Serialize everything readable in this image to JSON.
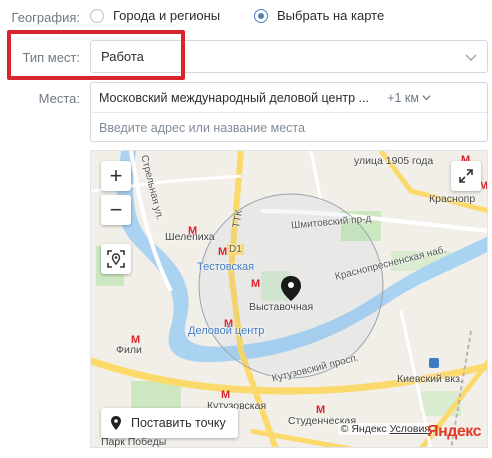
{
  "geography": {
    "label": "География:",
    "options": [
      {
        "label": "Города и регионы",
        "checked": false
      },
      {
        "label": "Выбрать на карте",
        "checked": true
      }
    ]
  },
  "place_type": {
    "label": "Тип мест:",
    "value": "Работа",
    "highlight_color": "#d9262e"
  },
  "places": {
    "label": "Места:",
    "selected": "Московский международный деловой центр ...",
    "radius": "+1 км",
    "input_placeholder": "Введите адрес или название места"
  },
  "map": {
    "zoom_in": "+",
    "zoom_out": "−",
    "set_point_label": "Поставить точку",
    "copyright": "© Яндекс",
    "terms": "Условия",
    "logo": "Яндекс",
    "labels": {
      "shelepikha": "Шелепиха",
      "testovskaya": "Тестовская",
      "vystavochnaya": "Выставочная",
      "delovoy": "Деловой центр",
      "fili": "Фили",
      "kutuzovskaya": "Кутузовская",
      "studencheskaya": "Студенческая",
      "park_pobedy": "Парк Победы",
      "kievsky": "Киевский вкз.",
      "krasnopr": "Краснопр",
      "year_street": "улица 1905 года",
      "shmitovsky": "Шмитовский пр-д",
      "krasnopresnenskaya": "Краснопресненская наб.",
      "kutuzovsky_prosp": "Кутузовский просп.",
      "ttk": "ТТК",
      "d1": "D1",
      "strelna": "Стрельная ул."
    },
    "colors": {
      "water": "#aad3f2",
      "roads_major": "#fcd96b",
      "park": "#cde8c0",
      "metro": "#d9262e",
      "accent": "#5181b8"
    }
  }
}
